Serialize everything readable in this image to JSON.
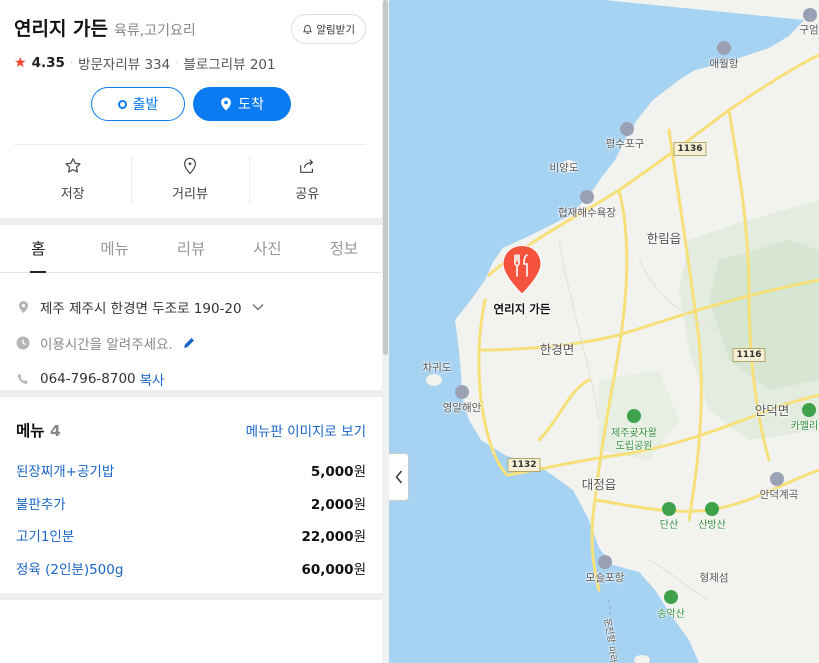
{
  "place": {
    "name": "연리지 가든",
    "category": "육류,고기요리",
    "alarm_label": "알림받기",
    "rating": "4.35",
    "visitor_review": "방문자리뷰 334",
    "blog_review": "블로그리뷰 201"
  },
  "route": {
    "start_label": "출발",
    "arrive_label": "도착"
  },
  "actions": {
    "save": "저장",
    "street_view": "거리뷰",
    "share": "공유"
  },
  "tabs": [
    "홈",
    "메뉴",
    "리뷰",
    "사진",
    "정보"
  ],
  "info": {
    "address": "제주 제주시 한경면 두조로 190-20",
    "hours": "이용시간을 알려주세요.",
    "phone": "064-796-8700",
    "copy_label": "복사"
  },
  "menu": {
    "title": "메뉴",
    "count": "4",
    "view_link": "메뉴판 이미지로 보기",
    "items": [
      {
        "name": "된장찌개+공기밥",
        "price": "5,000",
        "unit": "원"
      },
      {
        "name": "불판추가",
        "price": "2,000",
        "unit": "원"
      },
      {
        "name": "고기1인분",
        "price": "22,000",
        "unit": "원"
      },
      {
        "name": "정육 (2인분)500g",
        "price": "60,000",
        "unit": "원"
      }
    ]
  },
  "map": {
    "marker_label": "연리지 가든",
    "labels": {
      "aewol": "애월항",
      "gu": "구엄",
      "pyeongsu": "평수포구",
      "biyangdo": "비양도",
      "hyeopjae": "협재해수욕장",
      "hallim": "한림읍",
      "hangyeong": "한경면",
      "chagwido": "차귀도",
      "yeongal": "영알해안",
      "andeok": "안덕면",
      "camellia": "카멜리아",
      "gotjawal": "제주곶자왈",
      "gotjawal2": "도립공원",
      "daejeong": "대정읍",
      "andeok_valley": "안덕계곡",
      "dansan": "단산",
      "sanbang": "산방산",
      "moseulpo": "모슬포항",
      "hyeongje": "형제섬",
      "songak": "송악산",
      "unjin": "운진항",
      "mara": "마라"
    },
    "roads": [
      "1136",
      "1116",
      "1132"
    ],
    "colors": {
      "sea": "#a7d3f2",
      "land": "#f2f2ef",
      "road": "#f7e07a",
      "marker": "#f5533d"
    }
  }
}
